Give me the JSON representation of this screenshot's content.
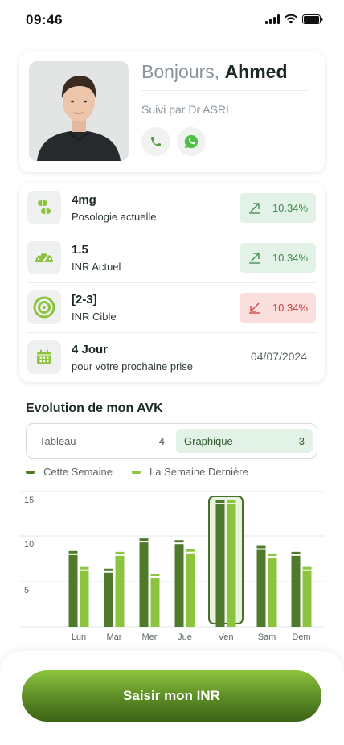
{
  "status_bar": {
    "time": "09:46"
  },
  "profile": {
    "greeting": "Bonjours,",
    "name": "Ahmed",
    "doctor": "Suivi par Dr ASRI",
    "actions": [
      {
        "icon": "phone-icon"
      },
      {
        "icon": "whatsapp-icon"
      }
    ]
  },
  "stats": [
    {
      "icon": "pill-icon",
      "value": "4mg",
      "label": "Posologie actuelle",
      "badge": "10.34%",
      "trend": "up"
    },
    {
      "icon": "gauge-icon",
      "value": "1.5",
      "label": "INR Actuel",
      "badge": "10.34%",
      "trend": "up"
    },
    {
      "icon": "target-icon",
      "value": "[2-3]",
      "label": "INR Cible",
      "badge": "10.34%",
      "trend": "down"
    },
    {
      "icon": "calendar-icon",
      "value": "4 Jour",
      "label": "pour votre prochaine prise",
      "date": "04/07/2024"
    }
  ],
  "evolution": {
    "title": "Evolution de mon AVK",
    "tabs": [
      {
        "label": "Tableau",
        "count": "4",
        "active": false
      },
      {
        "label": "Graphique",
        "count": "3",
        "active": true
      }
    ]
  },
  "colors": {
    "this_week": "#4f7a2b",
    "last_week": "#8cc43f",
    "up": "#3f8a4a",
    "down": "#cf3d3d"
  },
  "chart_data": {
    "type": "bar",
    "categories": [
      "Lun",
      "Mar",
      "Mer",
      "Jue",
      "Ven",
      "Sam",
      "Dem"
    ],
    "series": [
      {
        "name": "Cette Semaine",
        "values": [
          9,
          6.9,
          10.5,
          10.3,
          15,
          9.6,
          8.9
        ]
      },
      {
        "name": "La Semaine Dernière",
        "values": [
          7.1,
          8.9,
          6.3,
          9.2,
          15,
          8.7,
          7.1
        ]
      }
    ],
    "ylim": [
      0,
      15
    ],
    "yticks": [
      15,
      10,
      5
    ],
    "highlight": "Ven",
    "grid": true
  },
  "cta": {
    "label": "Saisir mon INR"
  }
}
